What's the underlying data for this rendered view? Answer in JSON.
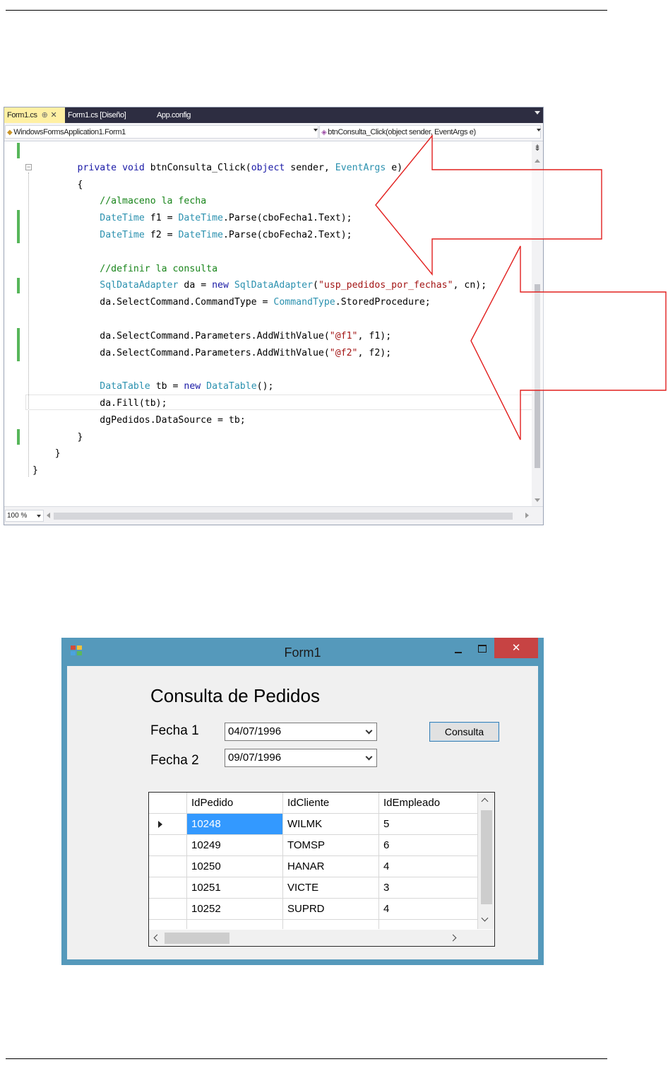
{
  "ide": {
    "tabs": [
      {
        "label": "Form1.cs",
        "pin": "⊕",
        "close": "✕"
      },
      {
        "label": "Form1.cs [Diseño]"
      },
      {
        "label": "App.config"
      }
    ],
    "nav_left": "WindowsFormsApplication1.Form1",
    "nav_right": "btnConsulta_Click(object sender, EventArgs e)",
    "zoom": "100 %",
    "code_lines": [
      [
        [
          "",
          ""
        ]
      ],
      [
        [
          "",
          "        "
        ],
        [
          "kw",
          "private"
        ],
        [
          "",
          " "
        ],
        [
          "kw",
          "void"
        ],
        [
          "",
          " btnConsulta_Click("
        ],
        [
          "kw",
          "object"
        ],
        [
          "",
          " sender, "
        ],
        [
          "ty",
          "EventArgs"
        ],
        [
          "",
          " e)"
        ]
      ],
      [
        [
          "",
          "        {"
        ]
      ],
      [
        [
          "",
          "            "
        ],
        [
          "cm",
          "//almaceno la fecha"
        ]
      ],
      [
        [
          "",
          "            "
        ],
        [
          "ty",
          "DateTime"
        ],
        [
          "",
          " f1 = "
        ],
        [
          "ty",
          "DateTime"
        ],
        [
          "",
          ".Parse(cboFecha1.Text);"
        ]
      ],
      [
        [
          "",
          "            "
        ],
        [
          "ty",
          "DateTime"
        ],
        [
          "",
          " f2 = "
        ],
        [
          "ty",
          "DateTime"
        ],
        [
          "",
          ".Parse(cboFecha2.Text);"
        ]
      ],
      [
        [
          "",
          ""
        ]
      ],
      [
        [
          "",
          "            "
        ],
        [
          "cm",
          "//definir la consulta"
        ]
      ],
      [
        [
          "",
          "            "
        ],
        [
          "ty",
          "SqlDataAdapter"
        ],
        [
          "",
          " da = "
        ],
        [
          "kw",
          "new"
        ],
        [
          "",
          " "
        ],
        [
          "ty",
          "SqlDataAdapter"
        ],
        [
          "",
          "("
        ],
        [
          "st",
          "\"usp_pedidos_por_fechas\""
        ],
        [
          "",
          ", cn);"
        ]
      ],
      [
        [
          "",
          "            da.SelectCommand.CommandType = "
        ],
        [
          "ty",
          "CommandType"
        ],
        [
          "",
          ".StoredProcedure;"
        ]
      ],
      [
        [
          "",
          ""
        ]
      ],
      [
        [
          "",
          "            da.SelectCommand.Parameters.AddWithValue("
        ],
        [
          "st",
          "\"@f1\""
        ],
        [
          "",
          ", f1);"
        ]
      ],
      [
        [
          "",
          "            da.SelectCommand.Parameters.AddWithValue("
        ],
        [
          "st",
          "\"@f2\""
        ],
        [
          "",
          ", f2);"
        ]
      ],
      [
        [
          "",
          ""
        ]
      ],
      [
        [
          "",
          "            "
        ],
        [
          "ty",
          "DataTable"
        ],
        [
          "",
          " tb = "
        ],
        [
          "kw",
          "new"
        ],
        [
          "",
          " "
        ],
        [
          "ty",
          "DataTable"
        ],
        [
          "",
          "();"
        ]
      ],
      [
        [
          "",
          "            da.Fill(tb);"
        ]
      ],
      [
        [
          "",
          "            dgPedidos.DataSource = tb;"
        ]
      ],
      [
        [
          "",
          "        }"
        ]
      ],
      [
        [
          "",
          "    }"
        ]
      ],
      [
        [
          "",
          "}"
        ]
      ]
    ]
  },
  "form": {
    "caption": "Form1",
    "close_glyph": "✕",
    "heading": "Consulta de Pedidos",
    "fecha1_label": "Fecha 1",
    "fecha1_value": "04/07/1996",
    "fecha2_label": "Fecha 2",
    "fecha2_value": "09/07/1996",
    "button_label": "Consulta",
    "grid": {
      "columns": [
        "IdPedido",
        "IdCliente",
        "IdEmpleado"
      ],
      "rows": [
        [
          "10248",
          "WILMK",
          "5"
        ],
        [
          "10249",
          "TOMSP",
          "6"
        ],
        [
          "10250",
          "HANAR",
          "4"
        ],
        [
          "10251",
          "VICTE",
          "3"
        ],
        [
          "10252",
          "SUPRD",
          "4"
        ]
      ],
      "selected_row": 0
    }
  },
  "colors": {
    "keyword": "#1a1aa6",
    "type": "#2b91af",
    "comment": "#19851b",
    "string": "#a31515",
    "arrow_outline": "#e2201f",
    "window_frame": "#5599bb",
    "close_button": "#c74343",
    "grid_selection": "#3399ff"
  }
}
